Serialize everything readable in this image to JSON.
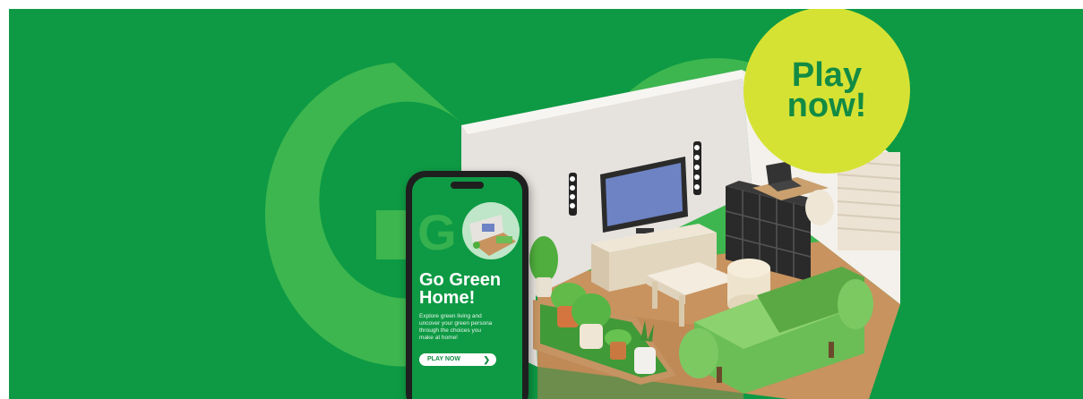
{
  "banner": {
    "background_color": "#0e9a44",
    "accent_light_green": "#3db64f",
    "badge_color": "#d6e233",
    "badge_text_color": "#128b44"
  },
  "badge": {
    "line1": "Play",
    "line2": "now!"
  },
  "background_letters": "Go",
  "phone": {
    "title_line1": "Go Green",
    "title_line2": "Home!",
    "description_lines": [
      "Explore green living and",
      "uncover your green persona",
      "through the choices you",
      "make at home!"
    ],
    "button_label": "PLAY NOW",
    "button_icon": "chevron-right-icon",
    "screen_letter": "G"
  }
}
